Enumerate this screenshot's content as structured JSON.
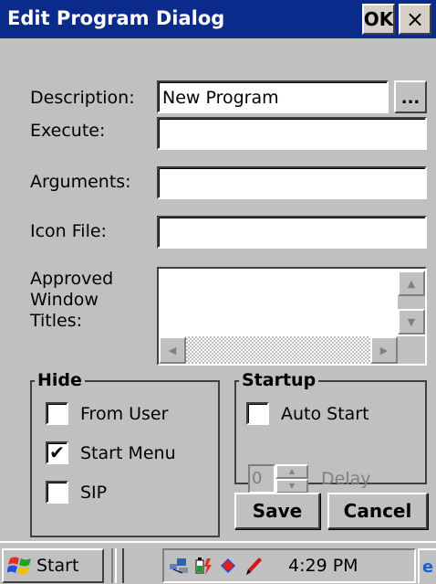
{
  "dialog": {
    "title": "Edit Program Dialog",
    "ok_label": "OK",
    "close_label": "×"
  },
  "form": {
    "description_label": "Description:",
    "description_value": "New Program",
    "browse_label": "...",
    "execute_label": "Execute:",
    "execute_value": "",
    "arguments_label": "Arguments:",
    "arguments_value": "",
    "icon_file_label": "Icon File:",
    "icon_file_value": "",
    "approved_titles_label_1": "Approved",
    "approved_titles_label_2": "Window",
    "approved_titles_label_3": "Titles:"
  },
  "hide": {
    "title": "Hide",
    "from_user": {
      "label": "From User",
      "checked": false
    },
    "start_menu": {
      "label": "Start Menu",
      "checked": true
    },
    "sip": {
      "label": "SIP",
      "checked": false
    }
  },
  "startup": {
    "title": "Startup",
    "auto_start": {
      "label": "Auto Start",
      "checked": false
    },
    "delay_value": "0",
    "delay_label": "Delay"
  },
  "buttons": {
    "save": "Save",
    "cancel": "Cancel"
  },
  "taskbar": {
    "start_label": "Start",
    "clock": "4:29 PM"
  },
  "icons": {
    "check_mark": "✔",
    "up_arrow": "▲",
    "down_arrow": "▼",
    "left_arrow": "◀",
    "right_arrow": "▶"
  },
  "colors": {
    "titlebar": "#0a2a8c",
    "window": "#c0c0c0"
  }
}
